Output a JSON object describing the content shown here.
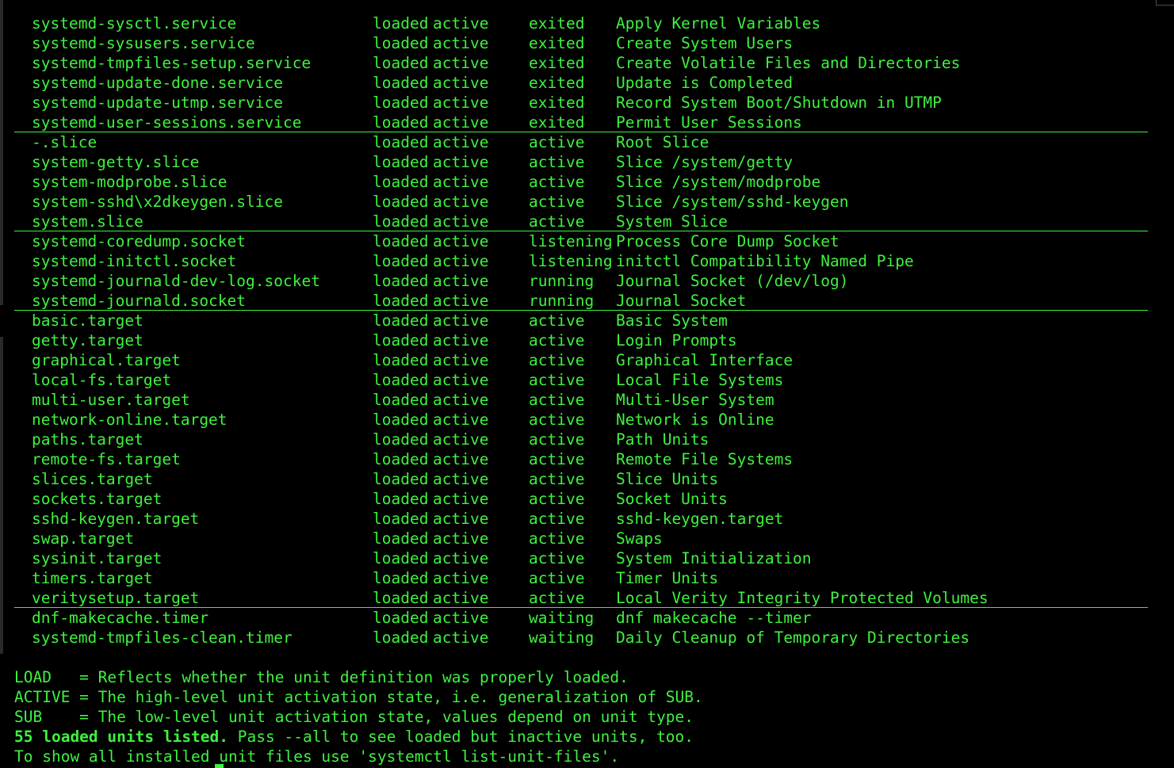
{
  "units": [
    {
      "unit": "systemd-sysctl.service",
      "load": "loaded",
      "active": "active",
      "sub": "exited",
      "description": "Apply Kernel Variables"
    },
    {
      "unit": "systemd-sysusers.service",
      "load": "loaded",
      "active": "active",
      "sub": "exited",
      "description": "Create System Users"
    },
    {
      "unit": "systemd-tmpfiles-setup.service",
      "load": "loaded",
      "active": "active",
      "sub": "exited",
      "description": "Create Volatile Files and Directories"
    },
    {
      "unit": "systemd-update-done.service",
      "load": "loaded",
      "active": "active",
      "sub": "exited",
      "description": "Update is Completed"
    },
    {
      "unit": "systemd-update-utmp.service",
      "load": "loaded",
      "active": "active",
      "sub": "exited",
      "description": "Record System Boot/Shutdown in UTMP"
    },
    {
      "unit": "systemd-user-sessions.service",
      "load": "loaded",
      "active": "active",
      "sub": "exited",
      "description": "Permit User Sessions"
    },
    {
      "unit": "-.slice",
      "load": "loaded",
      "active": "active",
      "sub": "active",
      "description": "Root Slice"
    },
    {
      "unit": "system-getty.slice",
      "load": "loaded",
      "active": "active",
      "sub": "active",
      "description": "Slice /system/getty"
    },
    {
      "unit": "system-modprobe.slice",
      "load": "loaded",
      "active": "active",
      "sub": "active",
      "description": "Slice /system/modprobe"
    },
    {
      "unit": "system-sshd\\x2dkeygen.slice",
      "load": "loaded",
      "active": "active",
      "sub": "active",
      "description": "Slice /system/sshd-keygen"
    },
    {
      "unit": "system.slice",
      "load": "loaded",
      "active": "active",
      "sub": "active",
      "description": "System Slice"
    },
    {
      "unit": "systemd-coredump.socket",
      "load": "loaded",
      "active": "active",
      "sub": "listening",
      "description": "Process Core Dump Socket"
    },
    {
      "unit": "systemd-initctl.socket",
      "load": "loaded",
      "active": "active",
      "sub": "listening",
      "description": "initctl Compatibility Named Pipe"
    },
    {
      "unit": "systemd-journald-dev-log.socket",
      "load": "loaded",
      "active": "active",
      "sub": "running",
      "description": "Journal Socket (/dev/log)"
    },
    {
      "unit": "systemd-journald.socket",
      "load": "loaded",
      "active": "active",
      "sub": "running",
      "description": "Journal Socket"
    },
    {
      "unit": "basic.target",
      "load": "loaded",
      "active": "active",
      "sub": "active",
      "description": "Basic System"
    },
    {
      "unit": "getty.target",
      "load": "loaded",
      "active": "active",
      "sub": "active",
      "description": "Login Prompts"
    },
    {
      "unit": "graphical.target",
      "load": "loaded",
      "active": "active",
      "sub": "active",
      "description": "Graphical Interface"
    },
    {
      "unit": "local-fs.target",
      "load": "loaded",
      "active": "active",
      "sub": "active",
      "description": "Local File Systems"
    },
    {
      "unit": "multi-user.target",
      "load": "loaded",
      "active": "active",
      "sub": "active",
      "description": "Multi-User System"
    },
    {
      "unit": "network-online.target",
      "load": "loaded",
      "active": "active",
      "sub": "active",
      "description": "Network is Online"
    },
    {
      "unit": "paths.target",
      "load": "loaded",
      "active": "active",
      "sub": "active",
      "description": "Path Units"
    },
    {
      "unit": "remote-fs.target",
      "load": "loaded",
      "active": "active",
      "sub": "active",
      "description": "Remote File Systems"
    },
    {
      "unit": "slices.target",
      "load": "loaded",
      "active": "active",
      "sub": "active",
      "description": "Slice Units"
    },
    {
      "unit": "sockets.target",
      "load": "loaded",
      "active": "active",
      "sub": "active",
      "description": "Socket Units"
    },
    {
      "unit": "sshd-keygen.target",
      "load": "loaded",
      "active": "active",
      "sub": "active",
      "description": "sshd-keygen.target"
    },
    {
      "unit": "swap.target",
      "load": "loaded",
      "active": "active",
      "sub": "active",
      "description": "Swaps"
    },
    {
      "unit": "sysinit.target",
      "load": "loaded",
      "active": "active",
      "sub": "active",
      "description": "System Initialization"
    },
    {
      "unit": "timers.target",
      "load": "loaded",
      "active": "active",
      "sub": "active",
      "description": "Timer Units"
    },
    {
      "unit": "veritysetup.target",
      "load": "loaded",
      "active": "active",
      "sub": "active",
      "description": "Local Verity Integrity Protected Volumes"
    },
    {
      "unit": "dnf-makecache.timer",
      "load": "loaded",
      "active": "active",
      "sub": "waiting",
      "description": "dnf makecache --timer"
    },
    {
      "unit": "systemd-tmpfiles-clean.timer",
      "load": "loaded",
      "active": "active",
      "sub": "waiting",
      "description": "Daily Cleanup of Temporary Directories"
    }
  ],
  "legend": {
    "load": "LOAD   = Reflects whether the unit definition was properly loaded.",
    "active": "ACTIVE = The high-level unit activation state, i.e. generalization of SUB.",
    "sub": "SUB    = The low-level unit activation state, values depend on unit type.",
    "summary_bold": "55 loaded units listed.",
    "summary_rest": " Pass --all to see loaded but inactive units, too.",
    "hint": "To show all installed unit files use 'systemctl list-unit-files'."
  },
  "colors": {
    "background": "#000000",
    "foreground": "#3ef23e"
  }
}
